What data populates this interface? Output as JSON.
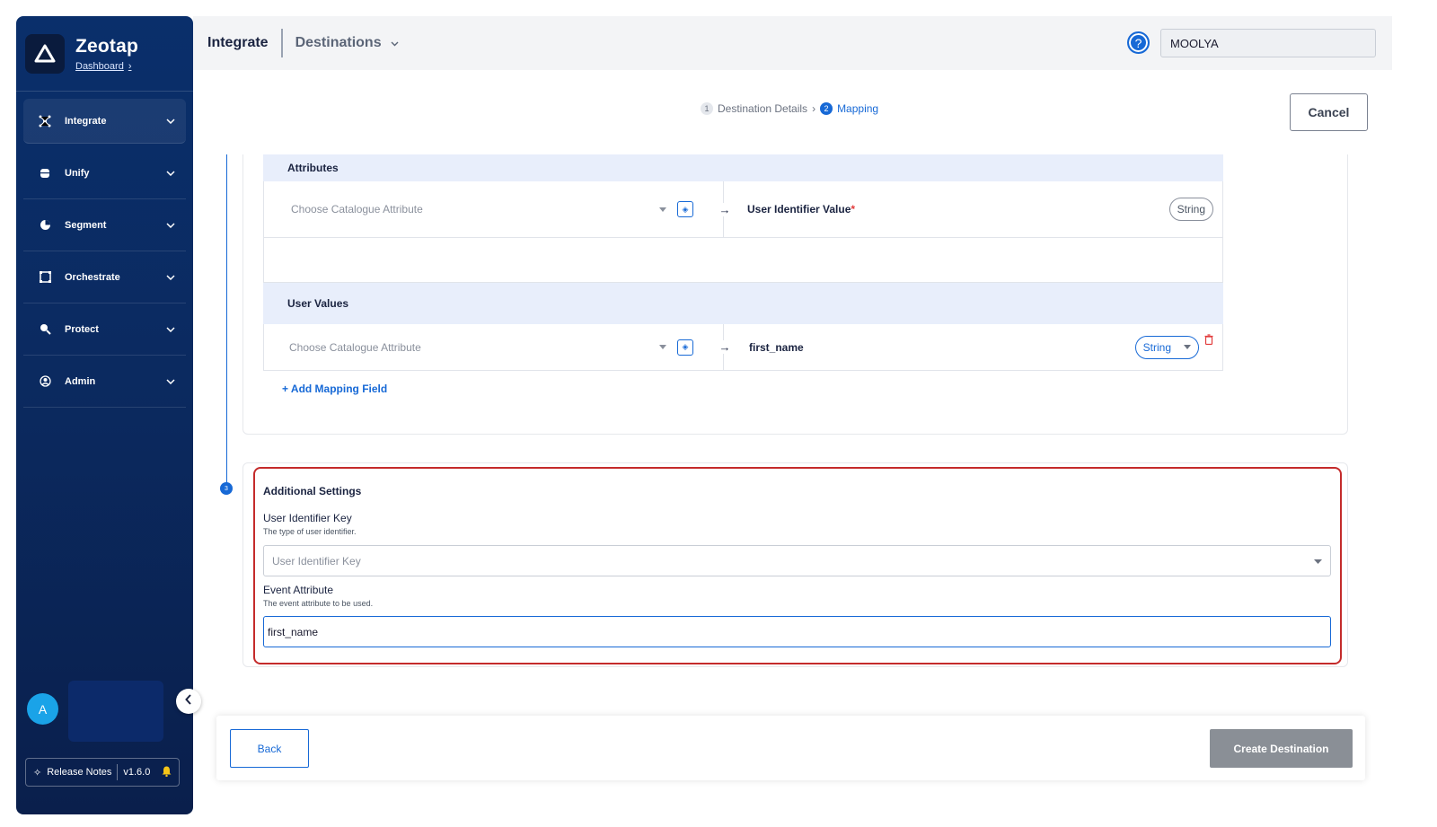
{
  "brand": {
    "name": "Zeotap",
    "link": "Dashboard"
  },
  "sidebar": {
    "items": [
      {
        "label": "Integrate",
        "icon": "integrate-icon"
      },
      {
        "label": "Unify",
        "icon": "database-icon"
      },
      {
        "label": "Segment",
        "icon": "segment-icon"
      },
      {
        "label": "Orchestrate",
        "icon": "orchestrate-icon"
      },
      {
        "label": "Protect",
        "icon": "protect-icon"
      },
      {
        "label": "Admin",
        "icon": "admin-icon"
      }
    ],
    "avatar_initial": "A",
    "release_label": "Release Notes",
    "version": "v1.6.0"
  },
  "header": {
    "title": "Integrate",
    "subtitle": "Destinations",
    "help": "?",
    "org": "MOOLYA"
  },
  "stepper": {
    "steps": [
      {
        "num": "1",
        "label": "Destination Details"
      },
      {
        "num": "2",
        "label": "Mapping"
      }
    ],
    "separator": "›"
  },
  "actions": {
    "cancel": "Cancel",
    "back": "Back",
    "create": "Create Destination"
  },
  "mapping": {
    "attributes_header": "Attributes",
    "user_values_header": "User Values",
    "placeholder": "Choose Catalogue Attribute",
    "arrow": "→",
    "rows": [
      {
        "target": "User Identifier Value",
        "required": "*",
        "type": "String"
      },
      {
        "target": "first_name",
        "type": "String"
      }
    ],
    "add_field": "+ Add Mapping Field"
  },
  "timeline": {
    "step": "3"
  },
  "settings": {
    "title": "Additional Settings",
    "user_key_label": "User Identifier Key",
    "user_key_hint": "The type of user identifier.",
    "user_key_placeholder": "User Identifier Key",
    "event_attr_label": "Event Attribute",
    "event_attr_hint": "The event attribute to be used.",
    "event_attr_value": "first_name"
  },
  "colors": {
    "primary": "#1769d6",
    "highlight": "#c42b2b",
    "sidebar": "#0a2f6b"
  }
}
